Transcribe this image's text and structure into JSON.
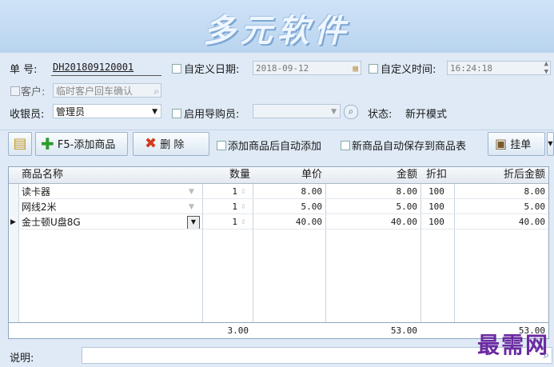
{
  "banner": {
    "title": "多元软件"
  },
  "form": {
    "order_no_label": "单  号:",
    "order_no": "DH201809120001",
    "custom_date_label": "自定义日期:",
    "custom_date": "2018-09-12",
    "custom_time_label": "自定义时间:",
    "custom_time": "16:24:18",
    "customer_label": "客户:",
    "customer_placeholder": "临时客户回车确认",
    "cashier_label": "收银员:",
    "cashier": "管理员",
    "guide_label": "启用导购员:",
    "status_label": "状态:",
    "status_value": "新开模式"
  },
  "toolbar": {
    "add_label": "F5-添加商品",
    "delete_label": "删  除",
    "auto_add_label": "添加商品后自动添加",
    "auto_save_label": "新商品自动保存到商品表",
    "hold_label": "挂单"
  },
  "table": {
    "headers": [
      "商品名称",
      "数量",
      "单价",
      "金额",
      "折扣",
      "折后金额"
    ],
    "rows": [
      {
        "name": "读卡器",
        "qty": "1",
        "price": "8.00",
        "amount": "8.00",
        "discount": "100",
        "final": "8.00"
      },
      {
        "name": "网线2米",
        "qty": "1",
        "price": "5.00",
        "amount": "5.00",
        "discount": "100",
        "final": "5.00"
      },
      {
        "name": "金士顿U盘8G",
        "qty": "1",
        "price": "40.00",
        "amount": "40.00",
        "discount": "100",
        "final": "40.00"
      }
    ],
    "totals": {
      "qty": "3.00",
      "amount": "53.00",
      "final": "53.00"
    }
  },
  "note": {
    "label": "说明:"
  },
  "watermark": "最需网",
  "colors": {
    "accent": "#7ea7d3",
    "background": "#dfeaf6",
    "watermark": "#6b2aa0"
  }
}
